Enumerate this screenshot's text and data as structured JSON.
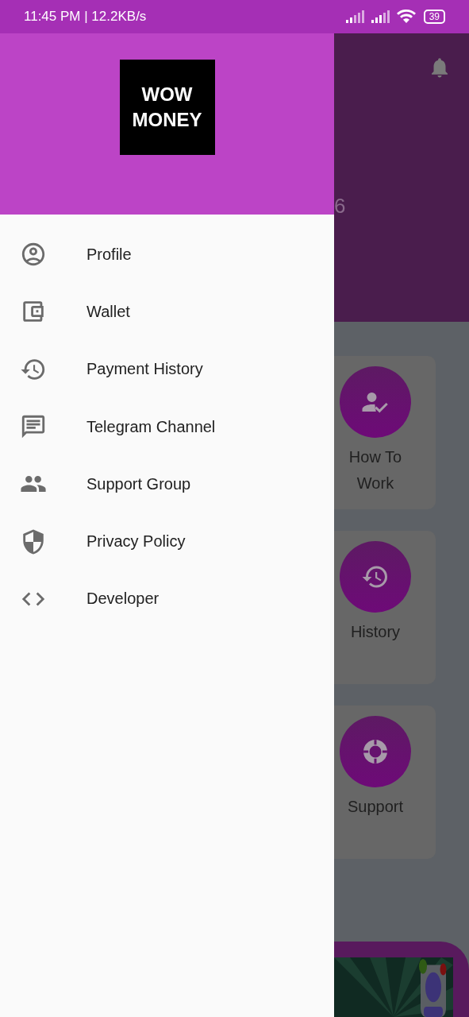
{
  "status_bar": {
    "time_speed": "11:45 PM | 12.2KB/s",
    "battery": "39"
  },
  "background_screen": {
    "balance_fragment": "6",
    "cards": [
      {
        "label": "How To Work"
      },
      {
        "label": "History"
      },
      {
        "label": "Support"
      }
    ]
  },
  "drawer": {
    "logo": {
      "lines": [
        "WOW",
        "MONEY"
      ]
    },
    "items": [
      {
        "label": "Profile"
      },
      {
        "label": "Wallet"
      },
      {
        "label": "Payment History"
      },
      {
        "label": "Telegram Channel"
      },
      {
        "label": "Support Group"
      },
      {
        "label": "Privacy Policy"
      },
      {
        "label": "Developer"
      }
    ]
  }
}
